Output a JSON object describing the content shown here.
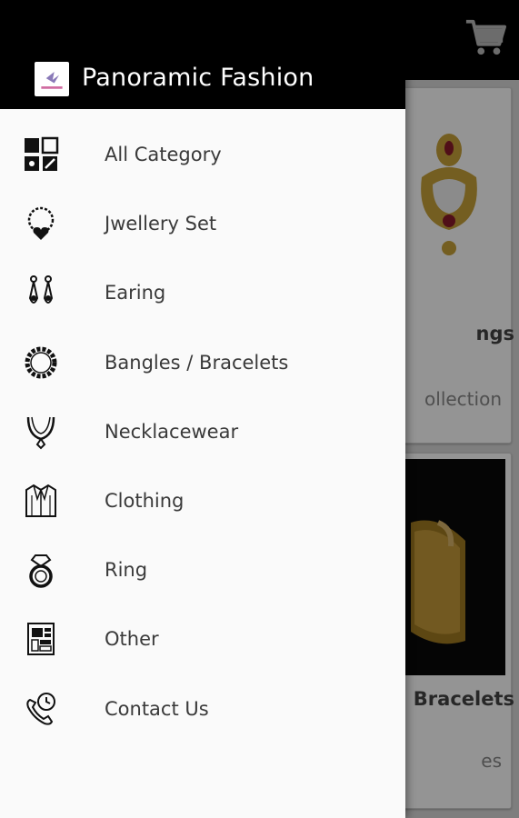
{
  "drawer": {
    "brand_title": "Panoramic Fashion",
    "items": [
      {
        "label": "All Category",
        "icon": "grid-category-icon"
      },
      {
        "label": "Jwellery Set",
        "icon": "necklace-heart-icon"
      },
      {
        "label": "Earing",
        "icon": "earring-icon"
      },
      {
        "label": "Bangles / Bracelets",
        "icon": "bangle-icon"
      },
      {
        "label": "Necklacewear",
        "icon": "necklace-icon"
      },
      {
        "label": "Clothing",
        "icon": "shirt-icon"
      },
      {
        "label": "Ring",
        "icon": "ring-icon"
      },
      {
        "label": "Other",
        "icon": "box-icon"
      },
      {
        "label": "Contact Us",
        "icon": "phone-clock-icon"
      }
    ]
  },
  "background": {
    "cards": [
      {
        "title": "ngs",
        "subtitle": "ollection"
      },
      {
        "title": "Bracelets",
        "subtitle": "es"
      }
    ]
  },
  "colors": {
    "topbar": "#000000",
    "drawer_bg": "#fafafa",
    "text": "#3a3a3a"
  }
}
